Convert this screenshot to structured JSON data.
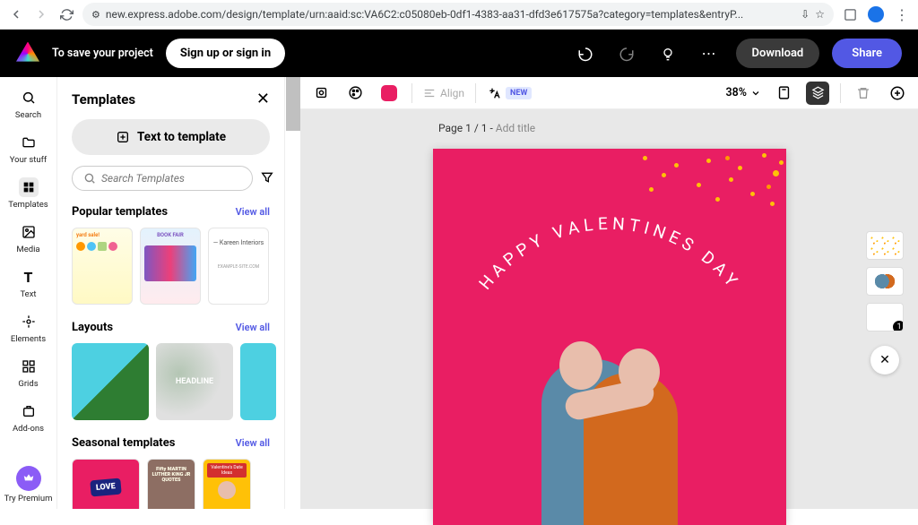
{
  "browser": {
    "url": "new.express.adobe.com/design/template/urn:aaid:sc:VA6C2:c05080eb-0df1-4383-aa31-dfd3e617575a?category=templates&entryP..."
  },
  "app_bar": {
    "save_text": "To save your project",
    "signup": "Sign up or sign in",
    "download": "Download",
    "share": "Share"
  },
  "toolbar": {
    "align": "Align",
    "new_badge": "NEW",
    "zoom": "38%"
  },
  "rail": {
    "items": [
      {
        "label": "Search"
      },
      {
        "label": "Your stuff"
      },
      {
        "label": "Templates"
      },
      {
        "label": "Media"
      },
      {
        "label": "Text"
      },
      {
        "label": "Elements"
      },
      {
        "label": "Grids"
      },
      {
        "label": "Add-ons"
      }
    ],
    "premium": "Try Premium"
  },
  "panel": {
    "title": "Templates",
    "text_to_template": "Text to template",
    "search_placeholder": "Search Templates",
    "sections": {
      "popular": {
        "title": "Popular templates",
        "view_all": "View all"
      },
      "layouts": {
        "title": "Layouts",
        "view_all": "View all"
      },
      "seasonal": {
        "title": "Seasonal templates",
        "view_all": "View all"
      }
    },
    "popular_cards": {
      "yard": "yard sale!",
      "book": "BOOK FAIR",
      "kareen": "— Kareen Interiors",
      "kareen_sub": "EXAMPLE-SITE.COM"
    },
    "layout_cards": {
      "headline": "HEADLINE"
    },
    "seasonal_cards": {
      "love": "LOVE",
      "mlk": "Fifty MARTIN LUTHER KING JR QUOTES",
      "vday": "Valentine's Date Ideas"
    }
  },
  "canvas": {
    "page_label_prefix": "Page 1 / 1 - ",
    "page_label_suffix": "Add title",
    "arc_text": "HAPPY VALENTINES DAY",
    "thumb_badge": "1"
  }
}
